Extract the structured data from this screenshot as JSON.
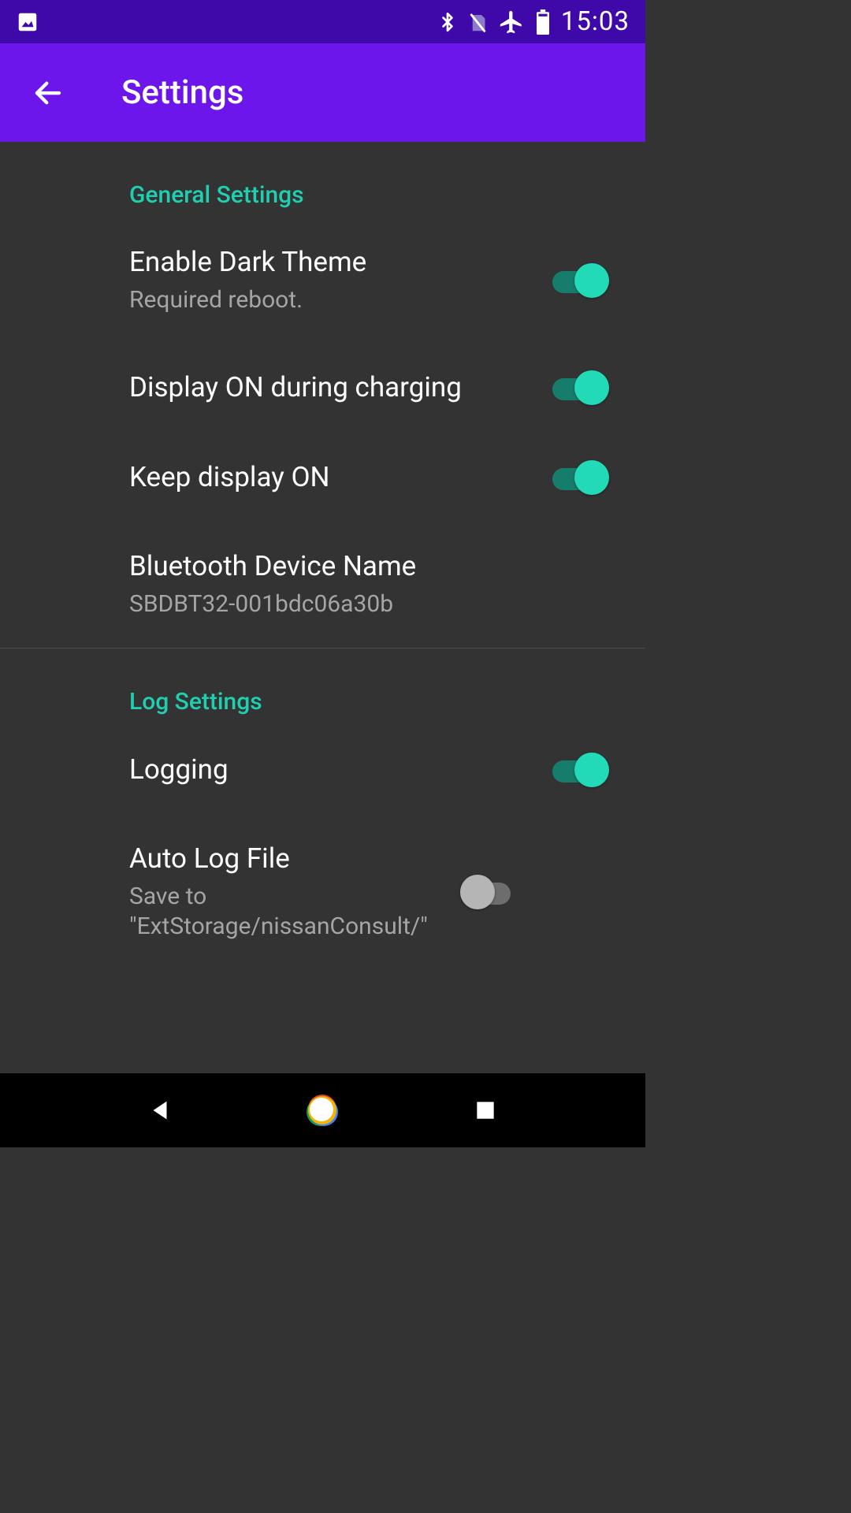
{
  "status": {
    "time": "15:03",
    "icons": {
      "screenshot": "screenshot-icon",
      "bluetooth": "bluetooth-icon",
      "nosim": "no-sim-icon",
      "airplane": "airplane-mode-icon",
      "battery": "battery-icon"
    }
  },
  "appbar": {
    "title": "Settings"
  },
  "sections": [
    {
      "header": "General Settings",
      "items": [
        {
          "title": "Enable Dark Theme",
          "subtitle": "Required reboot.",
          "toggle": true,
          "on": true
        },
        {
          "title": "Display ON during charging",
          "subtitle": null,
          "toggle": true,
          "on": true
        },
        {
          "title": "Keep display ON",
          "subtitle": null,
          "toggle": true,
          "on": true
        },
        {
          "title": "Bluetooth Device Name",
          "subtitle": "SBDBT32-001bdc06a30b",
          "toggle": false
        }
      ]
    },
    {
      "header": "Log Settings",
      "items": [
        {
          "title": "Logging",
          "subtitle": null,
          "toggle": true,
          "on": true
        },
        {
          "title": "Auto Log File",
          "subtitle": "Save to \"ExtStorage/nissanConsult/\"",
          "toggle": true,
          "on": false
        }
      ]
    }
  ],
  "colors": {
    "statusbar": "#3f08a8",
    "appbar": "#6c16ec",
    "surface": "#333333",
    "accent": "#22d9b8",
    "sectionHeader": "#1fcfb0"
  }
}
